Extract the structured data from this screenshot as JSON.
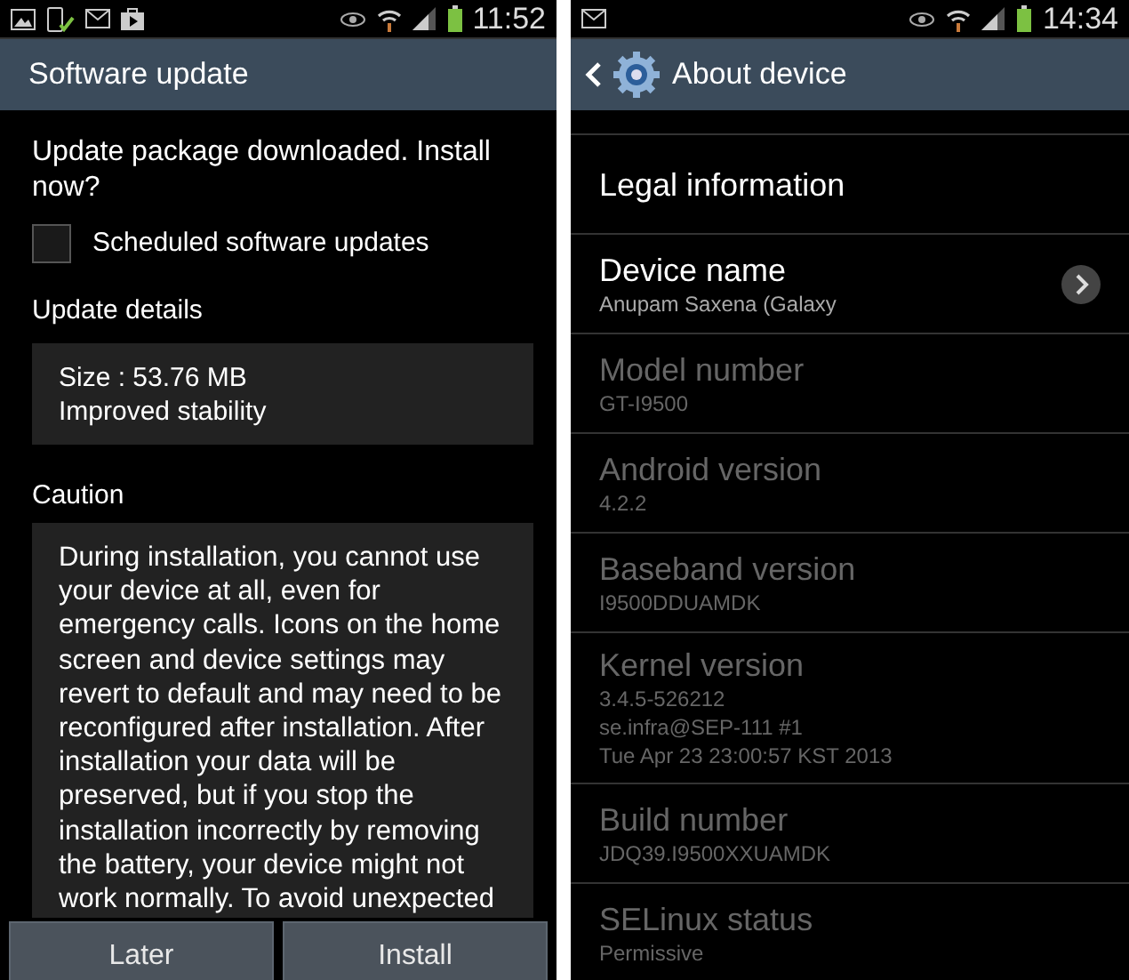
{
  "left_screen": {
    "status_bar": {
      "time": "11:52"
    },
    "action_bar": {
      "title": "Software update"
    },
    "prompt": "Update package downloaded. Install now?",
    "scheduled_updates": {
      "label": "Scheduled software updates",
      "checked": false
    },
    "details_heading": "Update details",
    "details": [
      "Size : 53.76 MB",
      "Improved stability"
    ],
    "caution_heading": "Caution",
    "caution_text": "During installation, you cannot use your device at all, even for emergency calls. Icons on the home screen and device settings may revert to default and may need to be reconfigured after installation. After installation your data will be preserved, but if you stop the installation incorrectly by removing the battery, your device might not work normally. To avoid unexpected",
    "buttons": [
      "Later",
      "Install"
    ]
  },
  "right_screen": {
    "status_bar": {
      "time": "14:34"
    },
    "action_bar": {
      "title": "About device"
    },
    "items": [
      {
        "title": "Legal information",
        "enabled": true,
        "has_arrow": false
      },
      {
        "title": "Device name",
        "subtitle": "Anupam Saxena (Galaxy",
        "enabled": true,
        "has_arrow": true
      },
      {
        "title": "Model number",
        "subtitle": "GT-I9500",
        "enabled": false,
        "has_arrow": false
      },
      {
        "title": "Android version",
        "subtitle": "4.2.2",
        "enabled": false,
        "has_arrow": false
      },
      {
        "title": "Baseband version",
        "subtitle": "I9500DDUAMDK",
        "enabled": false,
        "has_arrow": false
      },
      {
        "title": "Kernel version",
        "subtitle": "3.4.5-526212\nse.infra@SEP-111 #1\nTue Apr 23 23:00:57 KST 2013",
        "enabled": false,
        "has_arrow": false
      },
      {
        "title": "Build number",
        "subtitle": "JDQ39.I9500XXUAMDK",
        "enabled": false,
        "has_arrow": false
      },
      {
        "title": "SELinux status",
        "subtitle": "Permissive",
        "enabled": false,
        "has_arrow": false
      }
    ]
  }
}
